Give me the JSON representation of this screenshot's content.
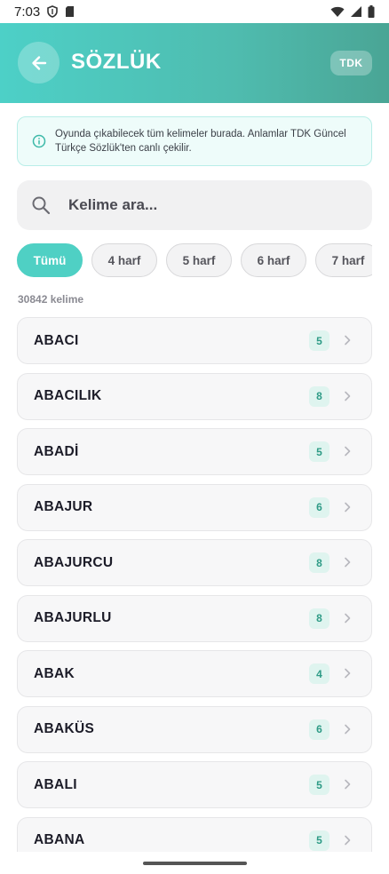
{
  "status_bar": {
    "time": "7:03"
  },
  "header": {
    "title": "SÖZLÜK",
    "badge": "TDK"
  },
  "info": {
    "text": "Oyunda çıkabilecek tüm kelimeler burada. Anlamlar TDK Güncel Türkçe Sözlük'ten canlı çekilir."
  },
  "search": {
    "placeholder": "Kelime ara..."
  },
  "filters": [
    {
      "label": "Tümü",
      "active": true
    },
    {
      "label": "4 harf",
      "active": false
    },
    {
      "label": "5 harf",
      "active": false
    },
    {
      "label": "6 harf",
      "active": false
    },
    {
      "label": "7 harf",
      "active": false
    }
  ],
  "count_text": "30842 kelime",
  "words": [
    {
      "word": "ABACI",
      "length": "5"
    },
    {
      "word": "ABACILIK",
      "length": "8"
    },
    {
      "word": "ABADİ",
      "length": "5"
    },
    {
      "word": "ABAJUR",
      "length": "6"
    },
    {
      "word": "ABAJURCU",
      "length": "8"
    },
    {
      "word": "ABAJURLU",
      "length": "8"
    },
    {
      "word": "ABAK",
      "length": "4"
    },
    {
      "word": "ABAKÜS",
      "length": "6"
    },
    {
      "word": "ABALI",
      "length": "5"
    },
    {
      "word": "ABANA",
      "length": "5"
    }
  ],
  "colors": {
    "accent": "#4fd0c4",
    "header_start": "#4dd0c7",
    "header_end": "#4aa595",
    "badge_text": "#2e9b86"
  },
  "icons": {
    "back": "arrow-left-icon",
    "info": "info-icon",
    "search": "search-icon",
    "chevron": "chevron-right-icon"
  }
}
